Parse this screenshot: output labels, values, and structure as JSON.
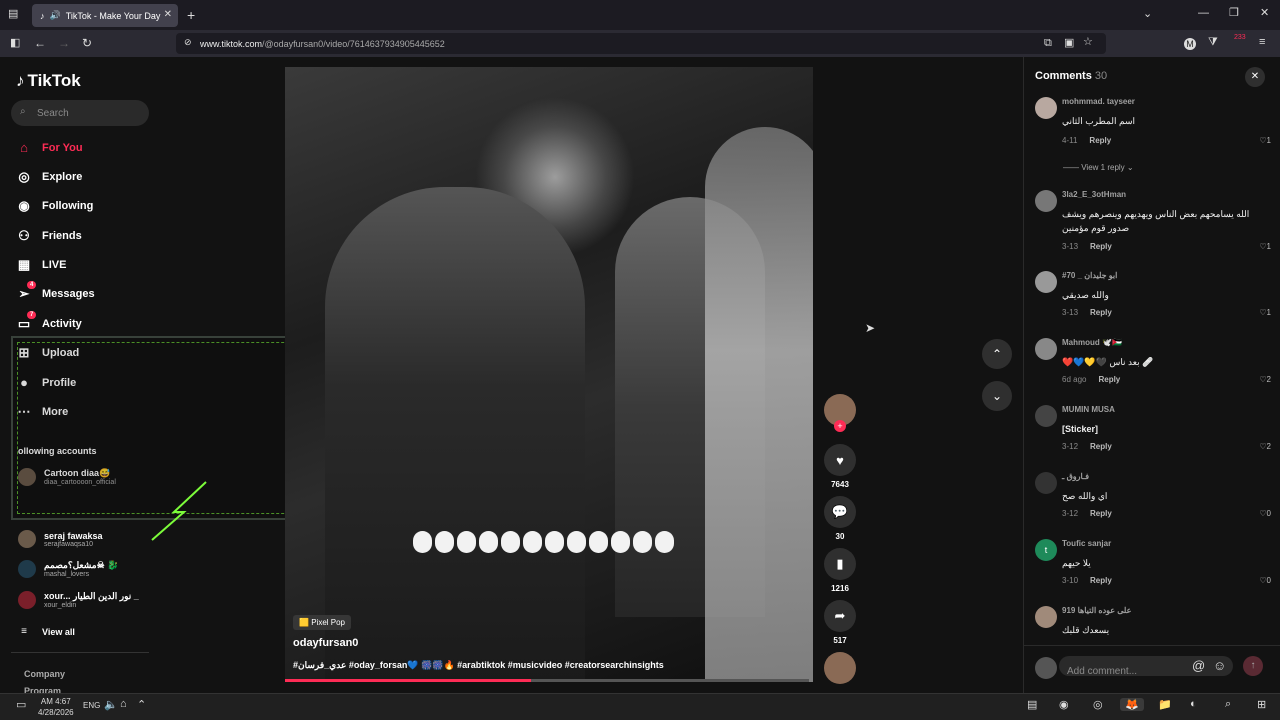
{
  "browser": {
    "tab_title": "TikTok - Make Your Day",
    "url_domain": "www.tiktok.com",
    "url_path": "/@odayfursan0/video/7614637934905445652",
    "extension_badge": "233"
  },
  "sidebar": {
    "logo": "TikTok",
    "search_placeholder": "Search",
    "nav": [
      {
        "label": "For You",
        "icon": "home-icon"
      },
      {
        "label": "Explore",
        "icon": "compass-icon"
      },
      {
        "label": "Following",
        "icon": "following-icon"
      },
      {
        "label": "Friends",
        "icon": "friends-icon"
      },
      {
        "label": "LIVE",
        "icon": "live-icon"
      },
      {
        "label": "Messages",
        "icon": "messages-icon",
        "badge": "4"
      },
      {
        "label": "Activity",
        "icon": "activity-icon",
        "badge": "7"
      },
      {
        "label": "Upload",
        "icon": "upload-icon"
      },
      {
        "label": "Profile",
        "icon": "profile-icon"
      },
      {
        "label": "More",
        "icon": "more-icon"
      }
    ],
    "following_heading": "ollowing accounts",
    "accounts": [
      {
        "name": "Cartoon diaa😅",
        "handle": "diaa_cartoooon_official"
      },
      {
        "name": "seraj fawaksa",
        "handle": "serajfawaqsa10"
      },
      {
        "name": "مشعل؟مصمم☠ 🐉",
        "handle": "mashal_lovers"
      },
      {
        "name": "xour... نور الدين الطيار _",
        "handle": "xour_eldin"
      }
    ],
    "view_all": "View all",
    "company": "Company",
    "program": "Program"
  },
  "video": {
    "tag": "Pixel Pop",
    "author": "odayfursan0",
    "caption": "#عدي_فرسان #oday_forsan💙 🎆🎆🔥 #arabtiktok #musicvideo #creatorsearchinsights",
    "progress": 0.47
  },
  "actions": {
    "likes": "7643",
    "comments": "30",
    "saves": "1216",
    "shares": "517"
  },
  "comments_panel": {
    "title": "Comments",
    "count": "30",
    "view_reply": "View 1 reply",
    "add_placeholder": "Add comment...",
    "items": [
      {
        "user": "mohmmad. tayseer",
        "text": "اسم المطرب الثاني",
        "date": "4-11",
        "reply": "Reply",
        "likes": "1"
      },
      {
        "user": "3la2_E_3otHman",
        "text": "الله يسامحهم بعض الناس ويهديهم وينصرهم ويشف صدور قوم مؤمنين",
        "date": "3-13",
        "reply": "Reply",
        "likes": "1"
      },
      {
        "user": "#70 _ ابو جليدان",
        "text": "والله صديقي",
        "date": "3-13",
        "reply": "Reply",
        "likes": "1"
      },
      {
        "user": "Mahmoud 🕊️🇯🇴",
        "text": "❤️💙💛🖤 بعد ناس 🩹",
        "date": "6d ago",
        "reply": "Reply",
        "likes": "2"
      },
      {
        "user": "MUMIN MUSA",
        "text": "[Sticker]",
        "date": "3-12",
        "reply": "Reply",
        "likes": "2"
      },
      {
        "user": "فـاروق ـ",
        "text": "اي والله صح",
        "date": "3-12",
        "reply": "Reply",
        "likes": "0"
      },
      {
        "user": "Toufic sanjar",
        "text": "يلا حيهم",
        "date": "3-10",
        "reply": "Reply",
        "likes": "0"
      },
      {
        "user": "919 على عوده التياها",
        "text": "يسعدك قلبك",
        "date": "",
        "reply": "",
        "likes": ""
      }
    ]
  },
  "taskbar": {
    "time": "AM 4:67",
    "date": "4/28/2026",
    "lang": "ENG"
  },
  "colors": {
    "accent": "#fe2c55",
    "frame": "#7cfc3a"
  }
}
